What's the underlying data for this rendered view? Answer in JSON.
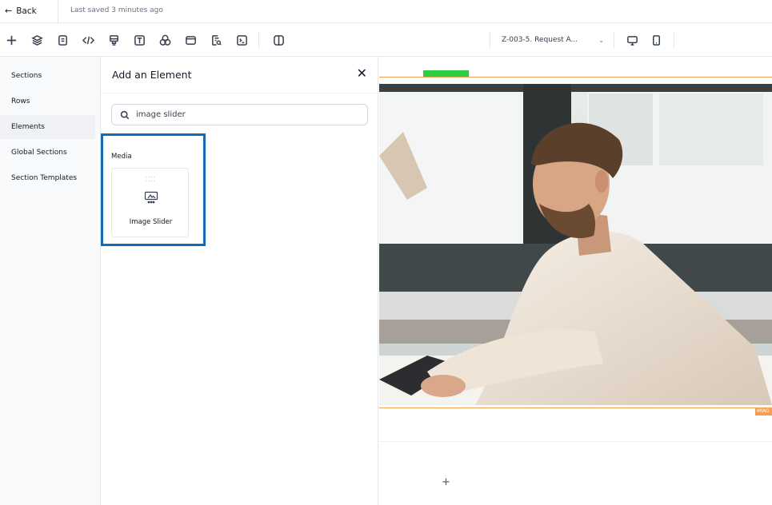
{
  "topbar": {
    "back_label": "Back",
    "back_icon": "arrow-left-icon",
    "saved_text": "Last saved 3 minutes ago"
  },
  "toolbar": {
    "icons": [
      "plus-icon",
      "layers-icon",
      "page-icon",
      "code-icon",
      "stamp-icon",
      "text-icon",
      "colors-icon",
      "window-icon",
      "page-search-icon",
      "terminal-icon",
      "columns-icon"
    ],
    "page_select_value": "Z-003-5. Request A...",
    "devices": [
      "desktop-icon",
      "mobile-icon"
    ]
  },
  "leftnav": {
    "items": [
      {
        "label": "Sections",
        "active": false
      },
      {
        "label": "Rows",
        "active": false
      },
      {
        "label": "Elements",
        "active": true
      },
      {
        "label": "Global Sections",
        "active": false
      },
      {
        "label": "Section Templates",
        "active": false
      }
    ]
  },
  "panel": {
    "title": "Add an Element",
    "close_icon": "close-icon",
    "search_value": "image slider",
    "search_icon": "search-icon",
    "group_label": "Media",
    "card_label": "Image Slider",
    "card_icon": "image-slider-icon",
    "highlight_color": "#1769b4"
  },
  "canvas": {
    "tag_text": "IMAG",
    "add_symbol": "+",
    "accent_green": "#2ecc40",
    "accent_orange": "#f59e52"
  }
}
